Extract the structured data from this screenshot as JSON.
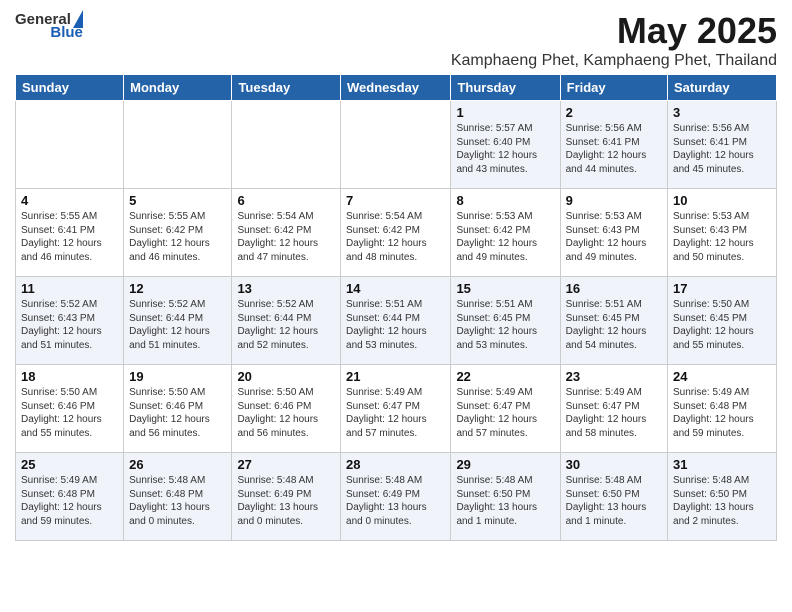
{
  "logo": {
    "general": "General",
    "blue": "Blue"
  },
  "title": "May 2025",
  "location": "Kamphaeng Phet, Kamphaeng Phet, Thailand",
  "days_of_week": [
    "Sunday",
    "Monday",
    "Tuesday",
    "Wednesday",
    "Thursday",
    "Friday",
    "Saturday"
  ],
  "weeks": [
    [
      {
        "day": "",
        "content": ""
      },
      {
        "day": "",
        "content": ""
      },
      {
        "day": "",
        "content": ""
      },
      {
        "day": "",
        "content": ""
      },
      {
        "day": "1",
        "content": "Sunrise: 5:57 AM\nSunset: 6:40 PM\nDaylight: 12 hours\nand 43 minutes."
      },
      {
        "day": "2",
        "content": "Sunrise: 5:56 AM\nSunset: 6:41 PM\nDaylight: 12 hours\nand 44 minutes."
      },
      {
        "day": "3",
        "content": "Sunrise: 5:56 AM\nSunset: 6:41 PM\nDaylight: 12 hours\nand 45 minutes."
      }
    ],
    [
      {
        "day": "4",
        "content": "Sunrise: 5:55 AM\nSunset: 6:41 PM\nDaylight: 12 hours\nand 46 minutes."
      },
      {
        "day": "5",
        "content": "Sunrise: 5:55 AM\nSunset: 6:42 PM\nDaylight: 12 hours\nand 46 minutes."
      },
      {
        "day": "6",
        "content": "Sunrise: 5:54 AM\nSunset: 6:42 PM\nDaylight: 12 hours\nand 47 minutes."
      },
      {
        "day": "7",
        "content": "Sunrise: 5:54 AM\nSunset: 6:42 PM\nDaylight: 12 hours\nand 48 minutes."
      },
      {
        "day": "8",
        "content": "Sunrise: 5:53 AM\nSunset: 6:42 PM\nDaylight: 12 hours\nand 49 minutes."
      },
      {
        "day": "9",
        "content": "Sunrise: 5:53 AM\nSunset: 6:43 PM\nDaylight: 12 hours\nand 49 minutes."
      },
      {
        "day": "10",
        "content": "Sunrise: 5:53 AM\nSunset: 6:43 PM\nDaylight: 12 hours\nand 50 minutes."
      }
    ],
    [
      {
        "day": "11",
        "content": "Sunrise: 5:52 AM\nSunset: 6:43 PM\nDaylight: 12 hours\nand 51 minutes."
      },
      {
        "day": "12",
        "content": "Sunrise: 5:52 AM\nSunset: 6:44 PM\nDaylight: 12 hours\nand 51 minutes."
      },
      {
        "day": "13",
        "content": "Sunrise: 5:52 AM\nSunset: 6:44 PM\nDaylight: 12 hours\nand 52 minutes."
      },
      {
        "day": "14",
        "content": "Sunrise: 5:51 AM\nSunset: 6:44 PM\nDaylight: 12 hours\nand 53 minutes."
      },
      {
        "day": "15",
        "content": "Sunrise: 5:51 AM\nSunset: 6:45 PM\nDaylight: 12 hours\nand 53 minutes."
      },
      {
        "day": "16",
        "content": "Sunrise: 5:51 AM\nSunset: 6:45 PM\nDaylight: 12 hours\nand 54 minutes."
      },
      {
        "day": "17",
        "content": "Sunrise: 5:50 AM\nSunset: 6:45 PM\nDaylight: 12 hours\nand 55 minutes."
      }
    ],
    [
      {
        "day": "18",
        "content": "Sunrise: 5:50 AM\nSunset: 6:46 PM\nDaylight: 12 hours\nand 55 minutes."
      },
      {
        "day": "19",
        "content": "Sunrise: 5:50 AM\nSunset: 6:46 PM\nDaylight: 12 hours\nand 56 minutes."
      },
      {
        "day": "20",
        "content": "Sunrise: 5:50 AM\nSunset: 6:46 PM\nDaylight: 12 hours\nand 56 minutes."
      },
      {
        "day": "21",
        "content": "Sunrise: 5:49 AM\nSunset: 6:47 PM\nDaylight: 12 hours\nand 57 minutes."
      },
      {
        "day": "22",
        "content": "Sunrise: 5:49 AM\nSunset: 6:47 PM\nDaylight: 12 hours\nand 57 minutes."
      },
      {
        "day": "23",
        "content": "Sunrise: 5:49 AM\nSunset: 6:47 PM\nDaylight: 12 hours\nand 58 minutes."
      },
      {
        "day": "24",
        "content": "Sunrise: 5:49 AM\nSunset: 6:48 PM\nDaylight: 12 hours\nand 59 minutes."
      }
    ],
    [
      {
        "day": "25",
        "content": "Sunrise: 5:49 AM\nSunset: 6:48 PM\nDaylight: 12 hours\nand 59 minutes."
      },
      {
        "day": "26",
        "content": "Sunrise: 5:48 AM\nSunset: 6:48 PM\nDaylight: 13 hours\nand 0 minutes."
      },
      {
        "day": "27",
        "content": "Sunrise: 5:48 AM\nSunset: 6:49 PM\nDaylight: 13 hours\nand 0 minutes."
      },
      {
        "day": "28",
        "content": "Sunrise: 5:48 AM\nSunset: 6:49 PM\nDaylight: 13 hours\nand 0 minutes."
      },
      {
        "day": "29",
        "content": "Sunrise: 5:48 AM\nSunset: 6:50 PM\nDaylight: 13 hours\nand 1 minute."
      },
      {
        "day": "30",
        "content": "Sunrise: 5:48 AM\nSunset: 6:50 PM\nDaylight: 13 hours\nand 1 minute."
      },
      {
        "day": "31",
        "content": "Sunrise: 5:48 AM\nSunset: 6:50 PM\nDaylight: 13 hours\nand 2 minutes."
      }
    ]
  ]
}
